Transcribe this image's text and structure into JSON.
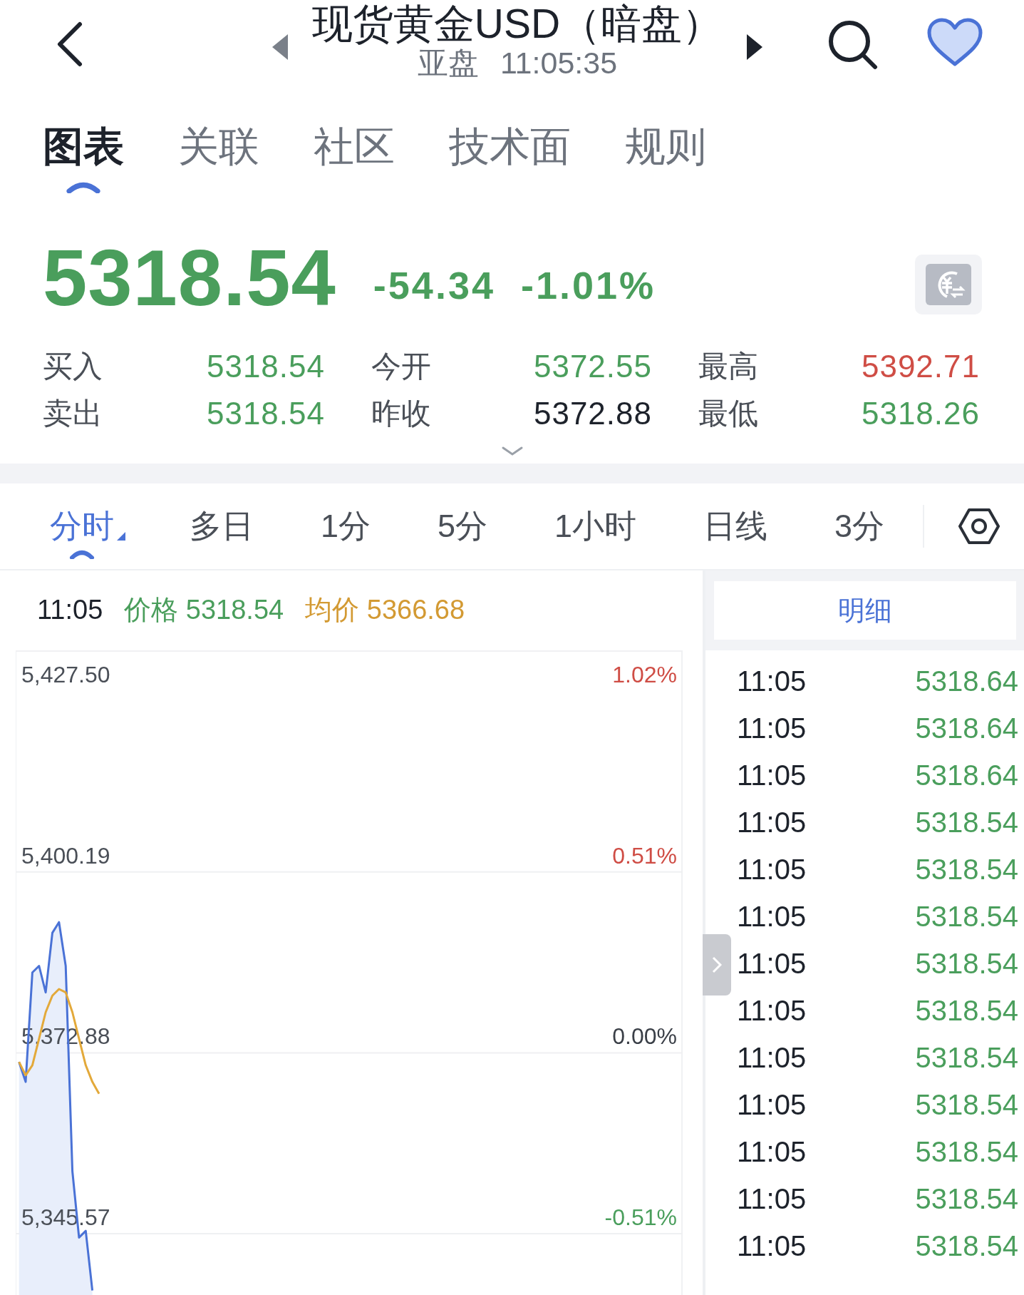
{
  "header": {
    "title": "现货黄金USD（暗盘）",
    "session": "亚盘",
    "time": "11:05:35",
    "favorite": true
  },
  "tabs": [
    {
      "label": "图表",
      "selected": true
    },
    {
      "label": "关联",
      "selected": false
    },
    {
      "label": "社区",
      "selected": false
    },
    {
      "label": "技术面",
      "selected": false
    },
    {
      "label": "规则",
      "selected": false
    }
  ],
  "quote": {
    "price": "5318.54",
    "change": "-54.34",
    "change_percent": "-1.01%",
    "stats": [
      {
        "label": "买入",
        "value": "5318.54",
        "color": "#4a9e5c"
      },
      {
        "label": "今开",
        "value": "5372.55",
        "color": "#4a9e5c"
      },
      {
        "label": "最高",
        "value": "5392.71",
        "color": "#cf4d45"
      },
      {
        "label": "卖出",
        "value": "5318.54",
        "color": "#4a9e5c"
      },
      {
        "label": "昨收",
        "value": "5372.88",
        "color": "#1d222b"
      },
      {
        "label": "最低",
        "value": "5318.26",
        "color": "#4a9e5c"
      }
    ]
  },
  "periods": [
    {
      "label": "分时",
      "selected": true
    },
    {
      "label": "多日",
      "selected": false
    },
    {
      "label": "1分",
      "selected": false
    },
    {
      "label": "5分",
      "selected": false
    },
    {
      "label": "1小时",
      "selected": false
    },
    {
      "label": "日线",
      "selected": false
    },
    {
      "label": "3分",
      "selected": false
    }
  ],
  "info": {
    "time": "11:05",
    "price": "5318.54",
    "average": "5366.68"
  },
  "chart": {
    "percent_labels": [
      {
        "text": "1.02%",
        "color": "#cf4d45"
      },
      {
        "text": "0.51%",
        "color": "#cf4d45"
      },
      {
        "text": "0.00%",
        "color": "#3a3f47"
      },
      {
        "text": "-0.51%",
        "color": "#4a9e5c"
      }
    ],
    "chart_data": {
      "type": "line",
      "grid": true,
      "categories": [
        null,
        null,
        null,
        null,
        null,
        null,
        null,
        null,
        null,
        null,
        null,
        null,
        null,
        null,
        null,
        null,
        null,
        null,
        null,
        null,
        null,
        null,
        null,
        null,
        null,
        null,
        null,
        null,
        null,
        null,
        null,
        null,
        null,
        null,
        null,
        null,
        null,
        null,
        null,
        null,
        null,
        null,
        null,
        null,
        null,
        null,
        null,
        null,
        null,
        null,
        null,
        null,
        null,
        null,
        null,
        null,
        null,
        null,
        null,
        null,
        null,
        null,
        null,
        null,
        null,
        null,
        null,
        null,
        null,
        null,
        null,
        null,
        null,
        null,
        null,
        null,
        null,
        null,
        null,
        null,
        null,
        null,
        null,
        null,
        null,
        null,
        null,
        null,
        null,
        null,
        null,
        null,
        null,
        null,
        null,
        null,
        null,
        null,
        null,
        null
      ],
      "ylim": [
        5336.32,
        5433.42
      ],
      "yticks": [
        {
          "value": 5427.5,
          "label": "5,427.50"
        },
        {
          "value": 5400.19,
          "label": "5,400.19"
        },
        {
          "value": 5372.88,
          "label": "5,372.88"
        },
        {
          "value": 5345.57,
          "label": "5,345.57"
        }
      ],
      "series": [
        {
          "name": "价格",
          "color": "#4a72d6",
          "values": [
            5371.5,
            5368.5,
            5385,
            5386,
            5382,
            5391,
            5392.6,
            5386,
            5355,
            5345,
            5346,
            5337,
            null,
            null,
            null,
            null,
            null,
            null,
            null,
            null,
            null,
            null,
            null,
            null,
            null,
            null,
            null,
            null,
            null,
            null,
            null,
            null,
            null,
            null,
            null,
            null,
            null,
            null,
            null,
            null,
            null,
            null,
            null,
            null,
            null,
            null,
            null,
            null,
            null,
            null,
            null,
            null,
            null,
            null,
            null,
            null,
            null,
            null,
            null,
            null,
            null,
            null,
            null,
            null,
            null,
            null,
            null,
            null,
            null,
            null,
            null,
            null,
            null,
            null,
            null,
            null,
            null,
            null,
            null,
            null,
            null,
            null,
            null,
            null,
            null,
            null,
            null,
            null,
            null,
            null,
            null,
            null,
            null,
            null,
            null,
            null,
            null,
            null,
            null,
            null
          ]
        },
        {
          "name": "均价",
          "color": "#e3a93a",
          "values": [
            5371.5,
            5369.5,
            5371,
            5375,
            5379,
            5381.5,
            5382.5,
            5382,
            5379,
            5375,
            5371,
            5368.5,
            5366.7,
            null,
            null,
            null,
            null,
            null,
            null,
            null,
            null,
            null,
            null,
            null,
            null,
            null,
            null,
            null,
            null,
            null,
            null,
            null,
            null,
            null,
            null,
            null,
            null,
            null,
            null,
            null,
            null,
            null,
            null,
            null,
            null,
            null,
            null,
            null,
            null,
            null,
            null,
            null,
            null,
            null,
            null,
            null,
            null,
            null,
            null,
            null,
            null,
            null,
            null,
            null,
            null,
            null,
            null,
            null,
            null,
            null,
            null,
            null,
            null,
            null,
            null,
            null,
            null,
            null,
            null,
            null,
            null,
            null,
            null,
            null,
            null,
            null,
            null,
            null,
            null,
            null,
            null,
            null,
            null,
            null,
            null,
            null,
            null,
            null,
            null,
            null
          ]
        }
      ]
    }
  },
  "details": {
    "button": "明细",
    "rows": [
      {
        "time": "11:05",
        "price": "5318.64"
      },
      {
        "time": "11:05",
        "price": "5318.64"
      },
      {
        "time": "11:05",
        "price": "5318.64"
      },
      {
        "time": "11:05",
        "price": "5318.54"
      },
      {
        "time": "11:05",
        "price": "5318.54"
      },
      {
        "time": "11:05",
        "price": "5318.54"
      },
      {
        "time": "11:05",
        "price": "5318.54"
      },
      {
        "time": "11:05",
        "price": "5318.54"
      },
      {
        "time": "11:05",
        "price": "5318.54"
      },
      {
        "time": "11:05",
        "price": "5318.54"
      },
      {
        "time": "11:05",
        "price": "5318.54"
      },
      {
        "time": "11:05",
        "price": "5318.54"
      },
      {
        "time": "11:05",
        "price": "5318.54"
      }
    ]
  }
}
